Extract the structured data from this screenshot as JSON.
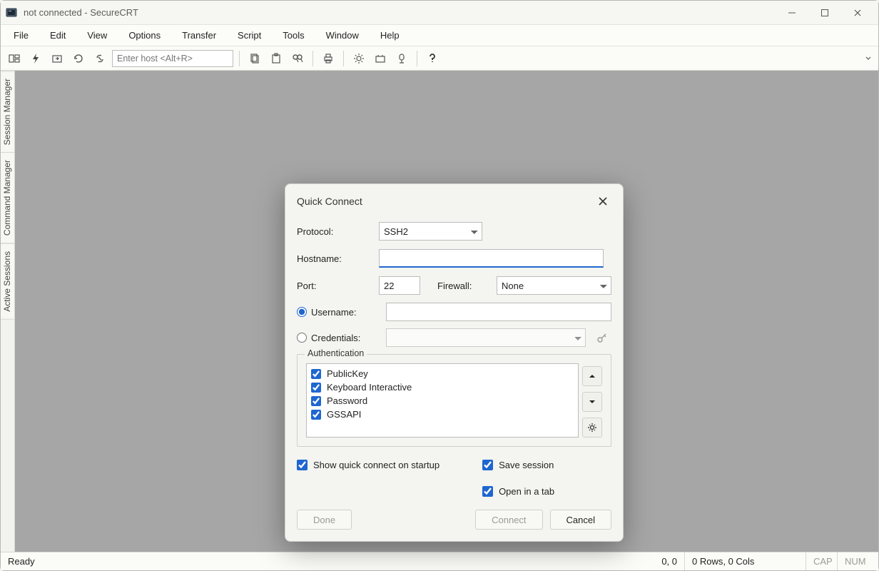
{
  "window": {
    "title": "not connected - SecureCRT"
  },
  "menubar": {
    "items": [
      "File",
      "Edit",
      "View",
      "Options",
      "Transfer",
      "Script",
      "Tools",
      "Window",
      "Help"
    ]
  },
  "toolbar": {
    "host_placeholder": "Enter host <Alt+R>"
  },
  "sidebar_tabs": [
    "Session Manager",
    "Command Manager",
    "Active Sessions"
  ],
  "dialog": {
    "title": "Quick Connect",
    "labels": {
      "protocol": "Protocol:",
      "hostname": "Hostname:",
      "port": "Port:",
      "firewall": "Firewall:",
      "username": "Username:",
      "credentials": "Credentials:"
    },
    "protocol_value": "SSH2",
    "hostname_value": "",
    "port_value": "22",
    "firewall_value": "None",
    "username_value": "",
    "auth_mode": "username",
    "authentication": {
      "legend": "Authentication",
      "items": [
        {
          "label": "PublicKey",
          "checked": true
        },
        {
          "label": "Keyboard Interactive",
          "checked": true
        },
        {
          "label": "Password",
          "checked": true
        },
        {
          "label": "GSSAPI",
          "checked": true
        }
      ]
    },
    "options": {
      "show_on_startup": {
        "label": "Show quick connect on startup",
        "checked": true
      },
      "save_session": {
        "label": "Save session",
        "checked": true
      },
      "open_in_tab": {
        "label": "Open in a tab",
        "checked": true
      }
    },
    "buttons": {
      "done": "Done",
      "connect": "Connect",
      "cancel": "Cancel"
    }
  },
  "statusbar": {
    "ready": "Ready",
    "cursor": "0, 0",
    "size": "0 Rows, 0 Cols",
    "cap": "CAP",
    "num": "NUM"
  }
}
